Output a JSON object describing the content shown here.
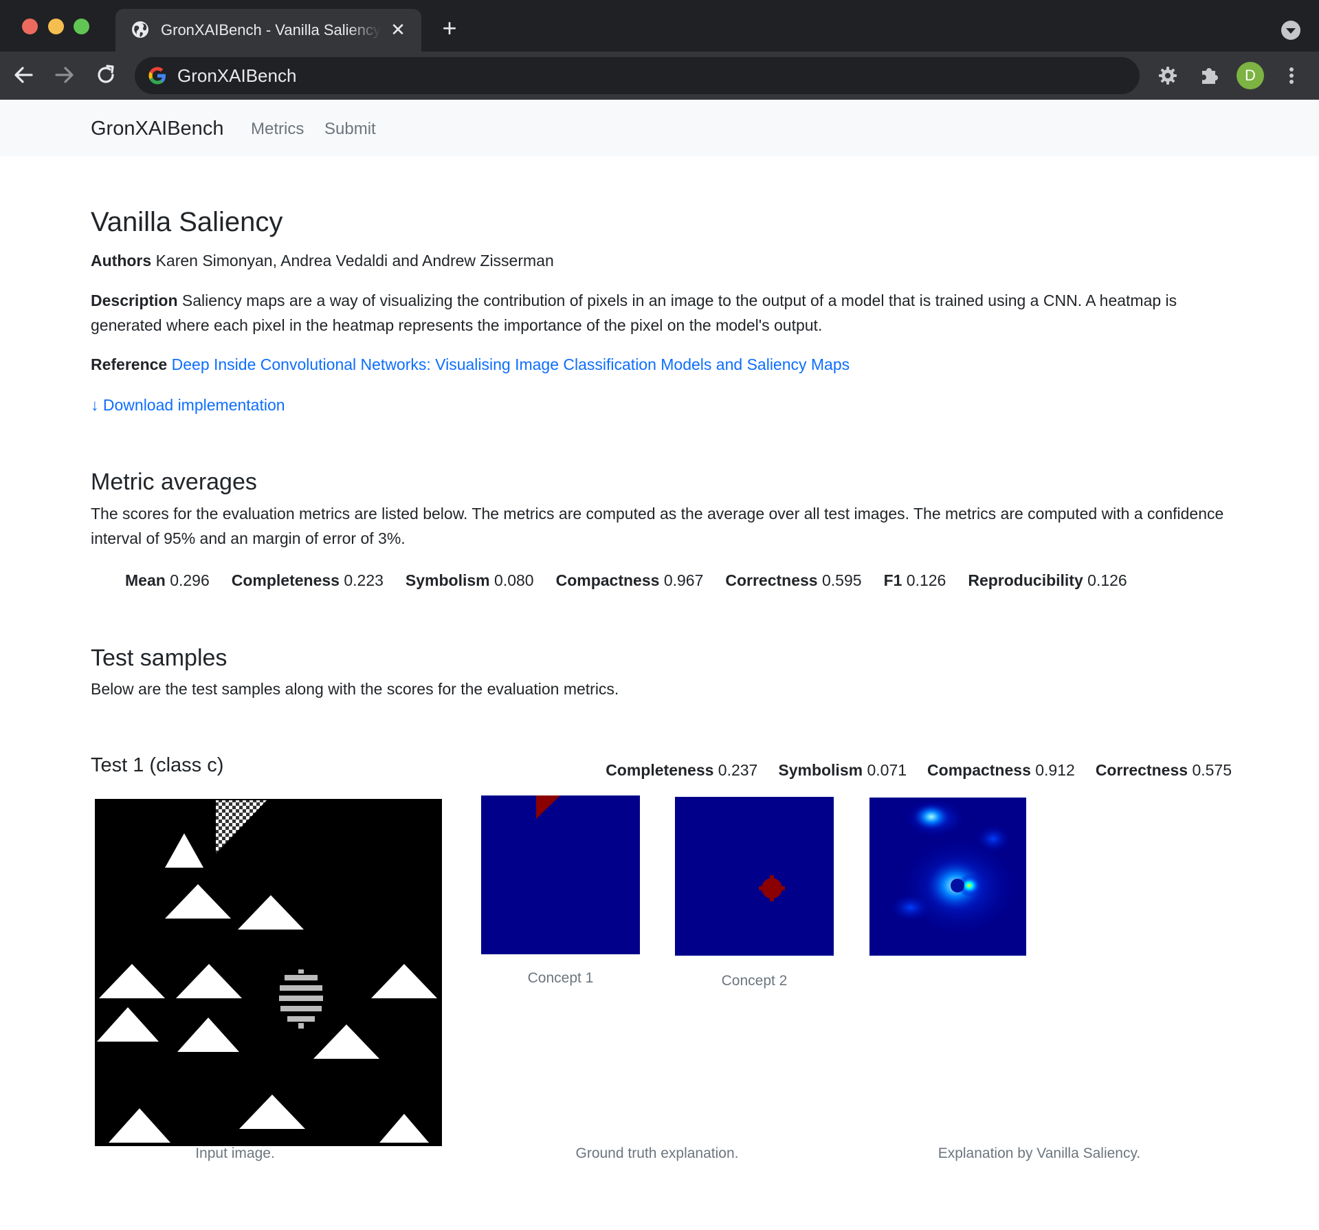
{
  "browser": {
    "tab_title": "GronXAIBench - Vanilla Saliency",
    "tab_close": "✕",
    "new_tab": "+",
    "url": "GronXAIBench",
    "avatar_letter": "D",
    "icons": [
      "globe-icon",
      "close-icon",
      "plus-icon",
      "back-arrow-icon",
      "forward-arrow-icon",
      "reload-icon",
      "google-icon",
      "gear-icon",
      "puzzle-icon",
      "kebab-icon"
    ]
  },
  "navbar": {
    "brand": "GronXAIBench",
    "links": [
      "Metrics",
      "Submit"
    ]
  },
  "method": {
    "title": "Vanilla Saliency",
    "authors_label": "Authors",
    "authors": "Karen Simonyan, Andrea Vedaldi and Andrew Zisserman",
    "description_label": "Description",
    "description": "Saliency maps are a way of visualizing the contribution of pixels in an image to the output of a model that is trained using a CNN. A heatmap is generated where each pixel in the heatmap represents the importance of the pixel on the model's output.",
    "reference_label": "Reference",
    "reference_text": "Deep Inside Convolutional Networks: Visualising Image Classification Models and Saliency Maps",
    "download_icon": "↓",
    "download_text": "Download implementation"
  },
  "metric_averages": {
    "title": "Metric averages",
    "intro": "The scores for the evaluation metrics are listed below. The metrics are computed as the average over all test images. The metrics are computed with a confidence interval of 95% and an margin of error of 3%.",
    "items": [
      {
        "label": "Mean",
        "value": "0.296"
      },
      {
        "label": "Completeness",
        "value": "0.223"
      },
      {
        "label": "Symbolism",
        "value": "0.080"
      },
      {
        "label": "Compactness",
        "value": "0.967"
      },
      {
        "label": "Correctness",
        "value": "0.595"
      },
      {
        "label": "F1",
        "value": "0.126"
      },
      {
        "label": "Reproducibility",
        "value": "0.126"
      }
    ]
  },
  "test_samples": {
    "title": "Test samples",
    "intro": "Below are the test samples along with the scores for the evaluation metrics.",
    "tests": [
      {
        "title": "Test 1 (class c)",
        "metrics": [
          {
            "label": "Completeness",
            "value": "0.237"
          },
          {
            "label": "Symbolism",
            "value": "0.071"
          },
          {
            "label": "Compactness",
            "value": "0.912"
          },
          {
            "label": "Correctness",
            "value": "0.575"
          }
        ],
        "concept_labels": [
          "Concept 1",
          "Concept 2"
        ],
        "captions": {
          "input": "Input image.",
          "ground_truth": "Ground truth explanation.",
          "explanation": "Explanation by Vanilla Saliency."
        }
      }
    ]
  },
  "colors": {
    "chrome_bg": "#202124",
    "toolbar_bg": "#35363a",
    "navbar_bg": "#f8f9fa",
    "link": "#0d6efd",
    "heatmap_bg": "#00008b",
    "concept_red": "#8b0000"
  }
}
